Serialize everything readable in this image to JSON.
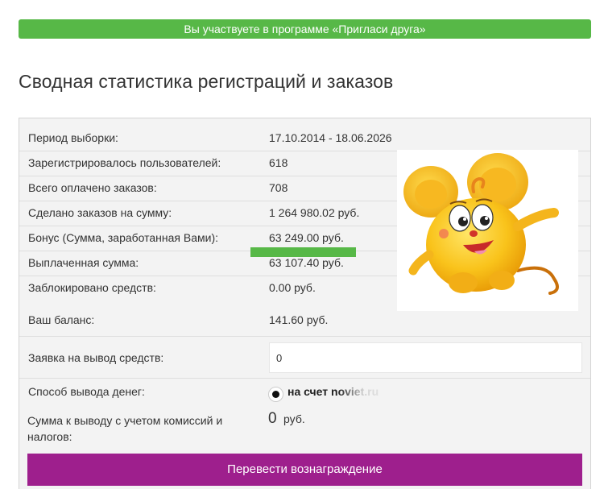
{
  "banner": {
    "text": "Вы участвуете в программе «Пригласи друга»"
  },
  "page": {
    "title": "Сводная статистика регистраций и заказов"
  },
  "stats": {
    "rows": [
      {
        "label": "Период выборки:",
        "value": "17.10.2014 - 18.06.2026"
      },
      {
        "label": "Зарегистрировалось пользователей:",
        "value": "618"
      },
      {
        "label": "Всего оплачено заказов:",
        "value": "708"
      },
      {
        "label": "Сделано заказов на сумму:",
        "value": "1 264 980.02 руб."
      },
      {
        "label": "Бонус (Сумма, заработанная Вами):",
        "value": "63 249.00 руб."
      },
      {
        "label": "Выплаченная сумма:",
        "value": "63 107.40 руб."
      },
      {
        "label": "Заблокировано средств:",
        "value": "0.00 руб."
      },
      {
        "label": "Ваш баланс:",
        "value": "141.60 руб."
      }
    ]
  },
  "withdraw": {
    "label": "Заявка на вывод средств:",
    "input_value": "0"
  },
  "method": {
    "label": "Способ вывода денег:",
    "option_label": "на счет noviet.ru",
    "selected": true
  },
  "payout": {
    "label": "Сумма к выводу с учетом комиссий и налогов:",
    "amount": "0",
    "currency": "руб."
  },
  "submit": {
    "label": "Перевести вознаграждение"
  },
  "colors": {
    "banner_green": "#57b847",
    "submit_purple": "#9e1f8d",
    "panel_bg": "#f3f3f3"
  },
  "icons": {
    "mascot": "smiling-yellow-mouse-mascot"
  }
}
